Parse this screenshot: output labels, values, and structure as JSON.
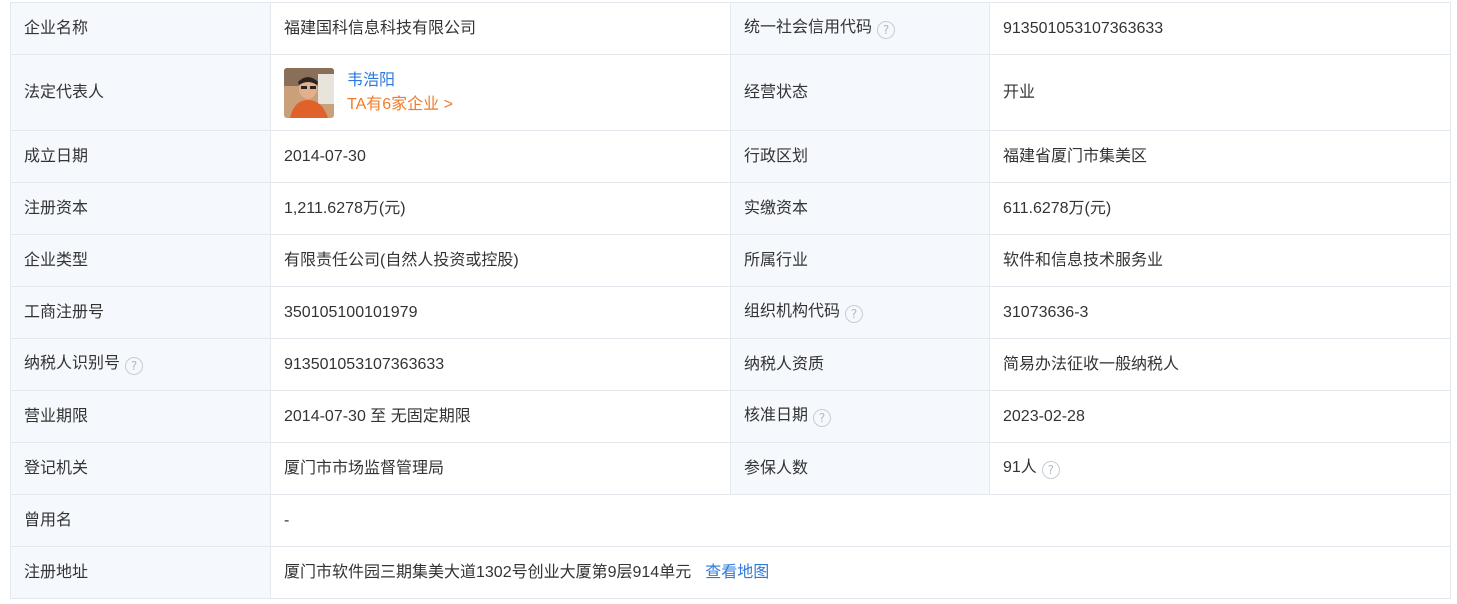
{
  "company": {
    "name_label": "企业名称",
    "name": "福建国科信息科技有限公司",
    "credit_code_label": "统一社会信用代码",
    "credit_code": "913501053107363633",
    "legal_rep_label": "法定代表人",
    "legal_rep_name": "韦浩阳",
    "legal_rep_companies": "TA有6家企业 >",
    "status_label": "经营状态",
    "status": "开业",
    "founded_label": "成立日期",
    "founded": "2014-07-30",
    "district_label": "行政区划",
    "district": "福建省厦门市集美区",
    "reg_capital_label": "注册资本",
    "reg_capital": "1,211.6278万(元)",
    "paid_capital_label": "实缴资本",
    "paid_capital": "611.6278万(元)",
    "type_label": "企业类型",
    "type": "有限责任公司(自然人投资或控股)",
    "industry_label": "所属行业",
    "industry": "软件和信息技术服务业",
    "reg_no_label": "工商注册号",
    "reg_no": "350105100101979",
    "org_code_label": "组织机构代码",
    "org_code": "31073636-3",
    "taxpayer_id_label": "纳税人识别号",
    "taxpayer_id": "913501053107363633",
    "taxpayer_qual_label": "纳税人资质",
    "taxpayer_qual": "简易办法征收一般纳税人",
    "term_label": "营业期限",
    "term": "2014-07-30 至 无固定期限",
    "approved_label": "核准日期",
    "approved": "2023-02-28",
    "authority_label": "登记机关",
    "authority": "厦门市市场监督管理局",
    "insured_label": "参保人数",
    "insured": "91人",
    "former_name_label": "曾用名",
    "former_name": "-",
    "address_label": "注册地址",
    "address": "厦门市软件园三期集美大道1302号创业大厦第9层914单元",
    "map_link": "查看地图"
  },
  "help_glyph": "?",
  "icons": {
    "help": "question-circle-icon",
    "avatar": "person-photo"
  },
  "colors": {
    "link": "#2e79db",
    "orange": "#f17c2a",
    "label_bg": "#f5f8fd",
    "border": "#e4e8ef"
  }
}
